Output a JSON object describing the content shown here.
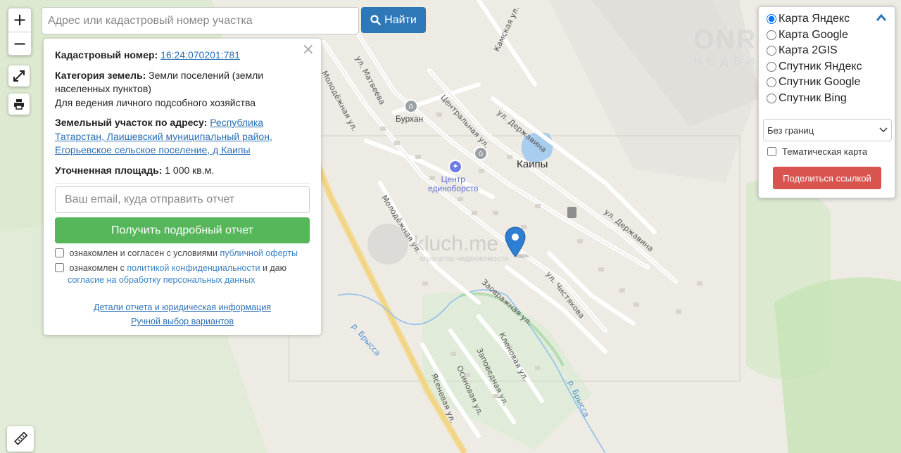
{
  "search": {
    "placeholder": "Адрес или кадастровый номер участка",
    "button_label": "Найти"
  },
  "zoom": {
    "in_label": "+",
    "out_label": "−"
  },
  "info": {
    "close_label": "×",
    "cadastral_label": "Кадастровый номер:",
    "cadastral_value": "16:24:070201:781",
    "category_label": "Категория земель:",
    "category_value": "Земли поселений (земли населенных пунктов)",
    "usage_value": "Для ведения личного подсобного хозяйства",
    "address_label": "Земельный участок по адресу:",
    "address_value": "Республика Татарстан, Лаишевский муниципальный район, Егорьевское сельское поселение, д Каипы",
    "area_label": "Уточненная площадь:",
    "area_value": "1 000 кв.м.",
    "email_placeholder": "Ваш email, куда отправить отчет",
    "report_button": "Получить подробный отчет",
    "agree1_text": "ознакомлен и согласен с условиями",
    "agree1_link": "публичной оферты",
    "agree2_prefix": "ознакомлен с",
    "agree2_link": "политикой конфиденциальности",
    "agree2_mid": "и даю",
    "agree2_link2": "согласие на обработку персональных данных",
    "details_link": "Детали отчета и юридическая информация",
    "manual_link": "Ручной выбор вариантов"
  },
  "layers": {
    "options": [
      "Карта Яндекс",
      "Карта Google",
      "Карта 2GIS",
      "Спутник Яндекс",
      "Спутник Google",
      "Спутник Bing"
    ],
    "selected": "Карта Яндекс",
    "borders_select": "Без границ",
    "thematic_label": "Тематическая карта",
    "share_button": "Поделиться ссылкой"
  },
  "map": {
    "village": "Каипы",
    "poi_burhan": "Бурхан",
    "poi_center_line1": "Центр",
    "poi_center_line2": "единоборств",
    "streets": {
      "matveeva": "ул. Матвеева",
      "molodezhnaya1": "Молодёжная ул.",
      "molodezhnaya2": "Молодёжная ул.",
      "centralnaya": "Центральная ул.",
      "derzhavina1": "ул. Державина",
      "derzhavina2": "ул. Державина",
      "kamskaya": "Камская ул.",
      "chistyakova": "ул. Чистякова",
      "zovrazhnaya": "Заовражная ул.",
      "klenovaya": "Кленовая ул.",
      "zapovednaya": "Заповедная ул.",
      "osinovaya": "Осиновая ул.",
      "yasenevaya": "Ясеневая ул."
    },
    "river1": "р. Брысса",
    "river2": "р. Брысса",
    "watermark_key": "kluch.me",
    "watermark_sub": "агрегатор недвижимости",
    "watermark_onr": "ONREALT",
    "watermark_onr_sub": "НЕДВИЖИМОСТЬ"
  },
  "colors": {
    "search_button": "#2f78b8",
    "report_button": "#55b65a",
    "share_button": "#d9534f",
    "link": "#2a6fb5",
    "marker": "#2d7fd3"
  }
}
